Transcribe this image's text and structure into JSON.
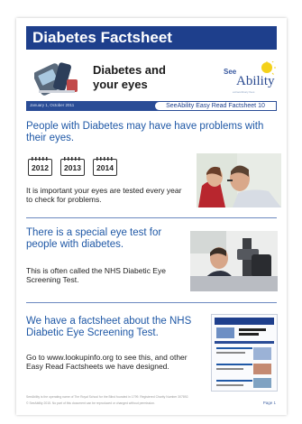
{
  "header": {
    "title": "Diabetes Factsheet",
    "subtitle": "Diabetes and your eyes",
    "date": "January 1, October 2011",
    "series": "SeeAbility Easy Read Factsheet 10"
  },
  "logo": {
    "line1": "See",
    "line2": "Ability",
    "tagline": "extraordinary lives"
  },
  "section1": {
    "heading": "People with Diabetes may have have problems with their eyes.",
    "years": [
      "2012",
      "2013",
      "2014"
    ],
    "body": "It is important your eyes are tested every year to check for problems."
  },
  "section2": {
    "heading": "There is a special eye test for people with diabetes.",
    "body": "This is often called the NHS Diabetic Eye Screening Test."
  },
  "section3": {
    "heading": "We have a factsheet about the NHS Diabetic Eye Screening Test.",
    "body": "Go to www.lookupinfo.org to see this, and other Easy Read Factsheets we have designed."
  },
  "footer": {
    "line1": "SeeAbility is the operating name of The Royal School for the Blind founded in 1799. Registered Charity Number 307892.",
    "line2": "© SeeAbility 2015. No part of this document can be reproduced or changed without permission.",
    "page": "Page 1"
  },
  "colors": {
    "title_bar": "#1e3f8c",
    "heading": "#1f58a6",
    "rule": "#6a88c0"
  },
  "icons": [
    "glucose-meter-icon",
    "calendar-icon"
  ]
}
